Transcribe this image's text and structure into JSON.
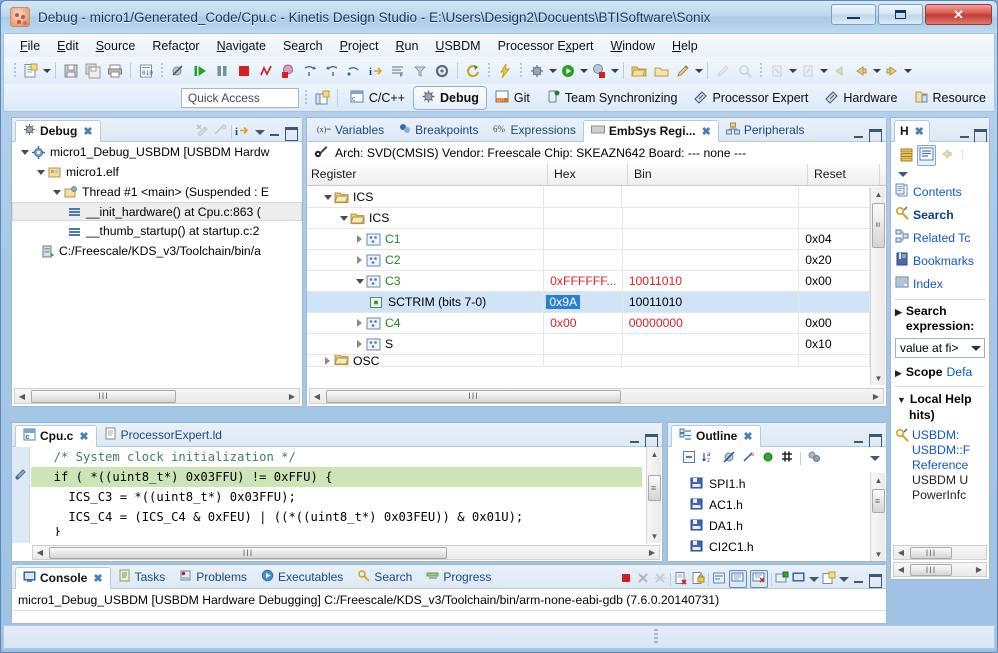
{
  "window": {
    "title": "Debug - micro1/Generated_Code/Cpu.c - Kinetis Design Studio - E:\\Users\\Design2\\Docuents\\BTISoftware\\Sonix",
    "minimize_label": "—",
    "maximize_label": "❐",
    "close_label": "✕",
    "app_icon": "kds-app-icon"
  },
  "menubar": [
    {
      "label": "File"
    },
    {
      "label": "Edit"
    },
    {
      "label": "Source"
    },
    {
      "label": "Refactor"
    },
    {
      "label": "Navigate"
    },
    {
      "label": "Search"
    },
    {
      "label": "Project"
    },
    {
      "label": "Run"
    },
    {
      "label": "USBDM"
    },
    {
      "label": "Processor Expert"
    },
    {
      "label": "Window"
    },
    {
      "label": "Help"
    }
  ],
  "toolbar": {
    "icons": [
      "new-file-icon",
      "new-dropdown-arrow",
      "save-icon",
      "save-all-icon",
      "print-icon",
      "bin-toggle-icon",
      "skip-breakpoints-icon",
      "resume-icon",
      "suspend-icon",
      "terminate-icon",
      "disconnect-icon",
      "remove-terminated-icon",
      "step-into-icon",
      "step-over-icon",
      "step-return-icon",
      "instruction-stepping-icon",
      "drop-to-frame-icon",
      "use-step-filters-icon",
      "settings-icon",
      "refresh-icon",
      "flash-icon",
      "debug-icon",
      "debug-dropdown-arrow",
      "run-icon",
      "run-dropdown-arrow",
      "external-tools-icon",
      "external-tools-dropdown-arrow",
      "open-folder-icon",
      "open-type-icon",
      "pencil-icon",
      "pencil-dropdown-arrow",
      "ruler-icon",
      "search-ref-icon",
      "next-annotation-icon",
      "next-annotation-dropdown-arrow",
      "prev-annotation-icon",
      "prev-annotation-dropdown-arrow",
      "back-icon",
      "forward-icon",
      "forward-dropdown-arrow",
      "next-edit-icon",
      "next-edit-dropdown-arrow"
    ]
  },
  "quick_access": {
    "placeholder": "Quick Access",
    "value": ""
  },
  "perspectives": {
    "open_perspective_icon": "open-perspective-icon",
    "tabs": [
      {
        "label": "C/C++",
        "icon": "cpp-perspective-icon",
        "active": false
      },
      {
        "label": "Debug",
        "icon": "debug-perspective-icon",
        "active": true
      },
      {
        "label": "Git",
        "icon": "git-perspective-icon",
        "active": false
      },
      {
        "label": "Team Synchronizing",
        "icon": "team-sync-icon",
        "active": false
      },
      {
        "label": "Processor Expert",
        "icon": "processor-expert-icon",
        "active": false
      },
      {
        "label": "Hardware",
        "icon": "hardware-icon",
        "active": false
      },
      {
        "label": "Resource",
        "icon": "resource-icon",
        "active": false
      }
    ]
  },
  "debug_view": {
    "tab_label": "Debug",
    "tab_icon": "debug-view-icon",
    "toolbar_icons": [
      "remove-all-terminated-icon",
      "remove-launch-icon",
      "show-debug-toolbar-icon"
    ],
    "tree": [
      {
        "indent": 0,
        "twist": "open",
        "icon": "launch-config-icon",
        "label": "micro1_Debug_USBDM [USBDM Hardw"
      },
      {
        "indent": 1,
        "twist": "open",
        "icon": "elf-file-icon",
        "label": "micro1.elf"
      },
      {
        "indent": 2,
        "twist": "open",
        "icon": "thread-icon",
        "label": "Thread #1 <main> (Suspended : E"
      },
      {
        "indent": 3,
        "twist": "none",
        "icon": "stack-frame-icon",
        "label": "__init_hardware() at Cpu.c:863 (",
        "selected": true
      },
      {
        "indent": 3,
        "twist": "none",
        "icon": "stack-frame-icon",
        "label": "__thumb_startup() at startup.c:2"
      },
      {
        "indent": 1,
        "twist": "none",
        "icon": "gdb-process-icon",
        "label": "C:/Freescale/KDS_v3/Toolchain/bin/a"
      }
    ],
    "hscroll_thumb": "III"
  },
  "registers_view": {
    "tabs": [
      {
        "label": "Variables",
        "icon": "variables-icon",
        "active": false
      },
      {
        "label": "Breakpoints",
        "icon": "breakpoints-icon",
        "active": false
      },
      {
        "label": "Expressions",
        "icon": "expressions-icon",
        "active": false
      },
      {
        "label": "EmbSys Regi...",
        "icon": "embsys-registers-icon",
        "active": true
      },
      {
        "label": "Peripherals",
        "icon": "peripherals-icon",
        "active": false
      }
    ],
    "info_icon": "embsys-config-icon",
    "info_line": "Arch: SVD(CMSIS)  Vendor: Freescale  Chip: SKEAZN642  Board: ---  none ---",
    "columns": [
      "Register",
      "Hex",
      "Bin",
      "Reset"
    ],
    "rows": [
      {
        "indent": 0,
        "twist": "open",
        "icon": "folder-icon",
        "name": "ICS",
        "hex": "",
        "bin": "",
        "reset": "",
        "name_color": "black"
      },
      {
        "indent": 1,
        "twist": "open",
        "icon": "folder-icon",
        "name": "ICS",
        "hex": "",
        "bin": "",
        "reset": "",
        "name_color": "black"
      },
      {
        "indent": 2,
        "twist": "closed",
        "icon": "register-icon",
        "name": "C1",
        "hex": "",
        "bin": "",
        "reset": "0x04",
        "name_color": "green"
      },
      {
        "indent": 2,
        "twist": "closed",
        "icon": "register-icon",
        "name": "C2",
        "hex": "",
        "bin": "",
        "reset": "0x20",
        "name_color": "green"
      },
      {
        "indent": 2,
        "twist": "open",
        "icon": "register-icon",
        "name": "C3",
        "hex": "0xFFFFFF...",
        "bin": "10011010",
        "reset": "0x00",
        "name_color": "green",
        "value_color": "red"
      },
      {
        "indent": 3,
        "twist": "none",
        "icon": "bitfield-icon",
        "name": "SCTRIM (bits 7-0)",
        "hex": "0x9A",
        "bin": "10011010",
        "reset": "",
        "name_color": "black",
        "selected": true,
        "editing": true
      },
      {
        "indent": 2,
        "twist": "closed",
        "icon": "register-icon",
        "name": "C4",
        "hex": "0x00",
        "bin": "00000000",
        "reset": "0x00",
        "name_color": "green",
        "value_color": "red"
      },
      {
        "indent": 2,
        "twist": "closed",
        "icon": "register-icon",
        "name": "S",
        "hex": "",
        "bin": "",
        "reset": "0x10",
        "name_color": "black"
      },
      {
        "indent": 0,
        "twist": "closed",
        "icon": "folder-icon",
        "name": "OSC",
        "hex": "",
        "bin": "",
        "reset": "",
        "name_color": "black"
      }
    ],
    "hscroll_thumb": "III"
  },
  "help_view": {
    "tab_label": "H",
    "toolbar_icons": [
      "show-all-topics-icon",
      "show-result-categories-icon",
      "back-icon",
      "forward-icon",
      "view-menu-icon"
    ],
    "links": [
      {
        "label": "Contents",
        "icon": "contents-icon",
        "bold": false
      },
      {
        "label": "Search",
        "icon": "search-scoped-icon",
        "bold": true
      },
      {
        "label": "Related Tc",
        "icon": "related-topics-icon",
        "bold": false
      },
      {
        "label": "Bookmarks",
        "icon": "bookmarks-icon",
        "bold": false
      },
      {
        "label": "Index",
        "icon": "index-icon",
        "bold": false
      }
    ],
    "search_section": {
      "title": "Search expression:",
      "expanded": true
    },
    "search_combo_value": "value at fi>",
    "scope_section": {
      "title": "Scope",
      "value": "Defa"
    },
    "local_help_section": {
      "title": "Local Help",
      "subtitle": "hits)",
      "expanded": true
    },
    "results": [
      {
        "icon": "help-result-icon",
        "lines": [
          "USBDM:",
          "USBDM::F",
          "Reference",
          "USBDM U",
          "PowerInfc"
        ]
      }
    ],
    "hscroll_thumb": "III"
  },
  "editor_view": {
    "tabs": [
      {
        "label": "Cpu.c",
        "icon": "c-file-icon",
        "active": true
      },
      {
        "label": "ProcessorExpert.ld",
        "icon": "ld-file-icon",
        "active": false
      }
    ],
    "lines": [
      {
        "text": "  /* System clock initialization */",
        "highlight": false,
        "type": "comment"
      },
      {
        "text": "  if ( *((uint8_t*) 0x03FFU) != 0xFFU) {",
        "highlight": true,
        "type": "code"
      },
      {
        "text": "    ICS_C3 = *((uint8_t*) 0x03FFU);",
        "highlight": false,
        "type": "code"
      },
      {
        "text": "    ICS_C4 = (ICS_C4 & 0xFEU) | ((*((uint8_t*) 0x03FEU)) & 0x01U);",
        "highlight": false,
        "type": "code"
      },
      {
        "text": "  }",
        "highlight": false,
        "type": "code"
      }
    ],
    "hscroll_thumb": "III"
  },
  "outline_view": {
    "tab_label": "Outline",
    "tab_icon": "outline-icon",
    "toolbar_icons": [
      "collapse-all-icon",
      "sort-icon",
      "hide-fields-icon",
      "hide-static-icon",
      "hide-nonpublic-icon",
      "hide-macros-icon",
      "filters-icon",
      "view-menu-icon"
    ],
    "items": [
      {
        "icon": "include-icon",
        "label": "SPI1.h"
      },
      {
        "icon": "include-icon",
        "label": "AC1.h"
      },
      {
        "icon": "include-icon",
        "label": "DA1.h"
      },
      {
        "icon": "include-icon",
        "label": "CI2C1.h"
      }
    ]
  },
  "console_view": {
    "tabs": [
      {
        "label": "Console",
        "icon": "console-icon",
        "active": true
      },
      {
        "label": "Tasks",
        "icon": "tasks-icon",
        "active": false
      },
      {
        "label": "Problems",
        "icon": "problems-icon",
        "active": false
      },
      {
        "label": "Executables",
        "icon": "executables-icon",
        "active": false
      },
      {
        "label": "Search",
        "icon": "search-icon",
        "active": false
      },
      {
        "label": "Progress",
        "icon": "progress-icon",
        "active": false
      }
    ],
    "toolbar_icons": [
      "terminate-icon",
      "remove-launch-icon",
      "remove-all-terminated-icon",
      "clear-console-icon",
      "scroll-lock-icon",
      "word-wrap-icon",
      "show-console-icon",
      "display-selected-console-icon",
      "pin-console-icon",
      "open-console-icon",
      "open-console-dropdown-arrow",
      "new-console-view-icon",
      "new-console-dropdown-arrow"
    ],
    "content_line": "micro1_Debug_USBDM [USBDM Hardware Debugging] C:/Freescale/KDS_v3/Toolchain/bin/arm-none-eabi-gdb (7.6.0.20140731)"
  },
  "statusbar": {
    "grip_icon": "resize-grip-icon",
    "text": ""
  },
  "colors": {
    "title_blue": "#12365e",
    "accent_link": "#1155cc",
    "selection": "#cfe4f7",
    "edit_highlight": "#2a7fd4",
    "value_red": "#e02020",
    "register_green": "#1a8a1a",
    "code_highlight": "#cce4b6",
    "close_red": "#d9534a"
  }
}
